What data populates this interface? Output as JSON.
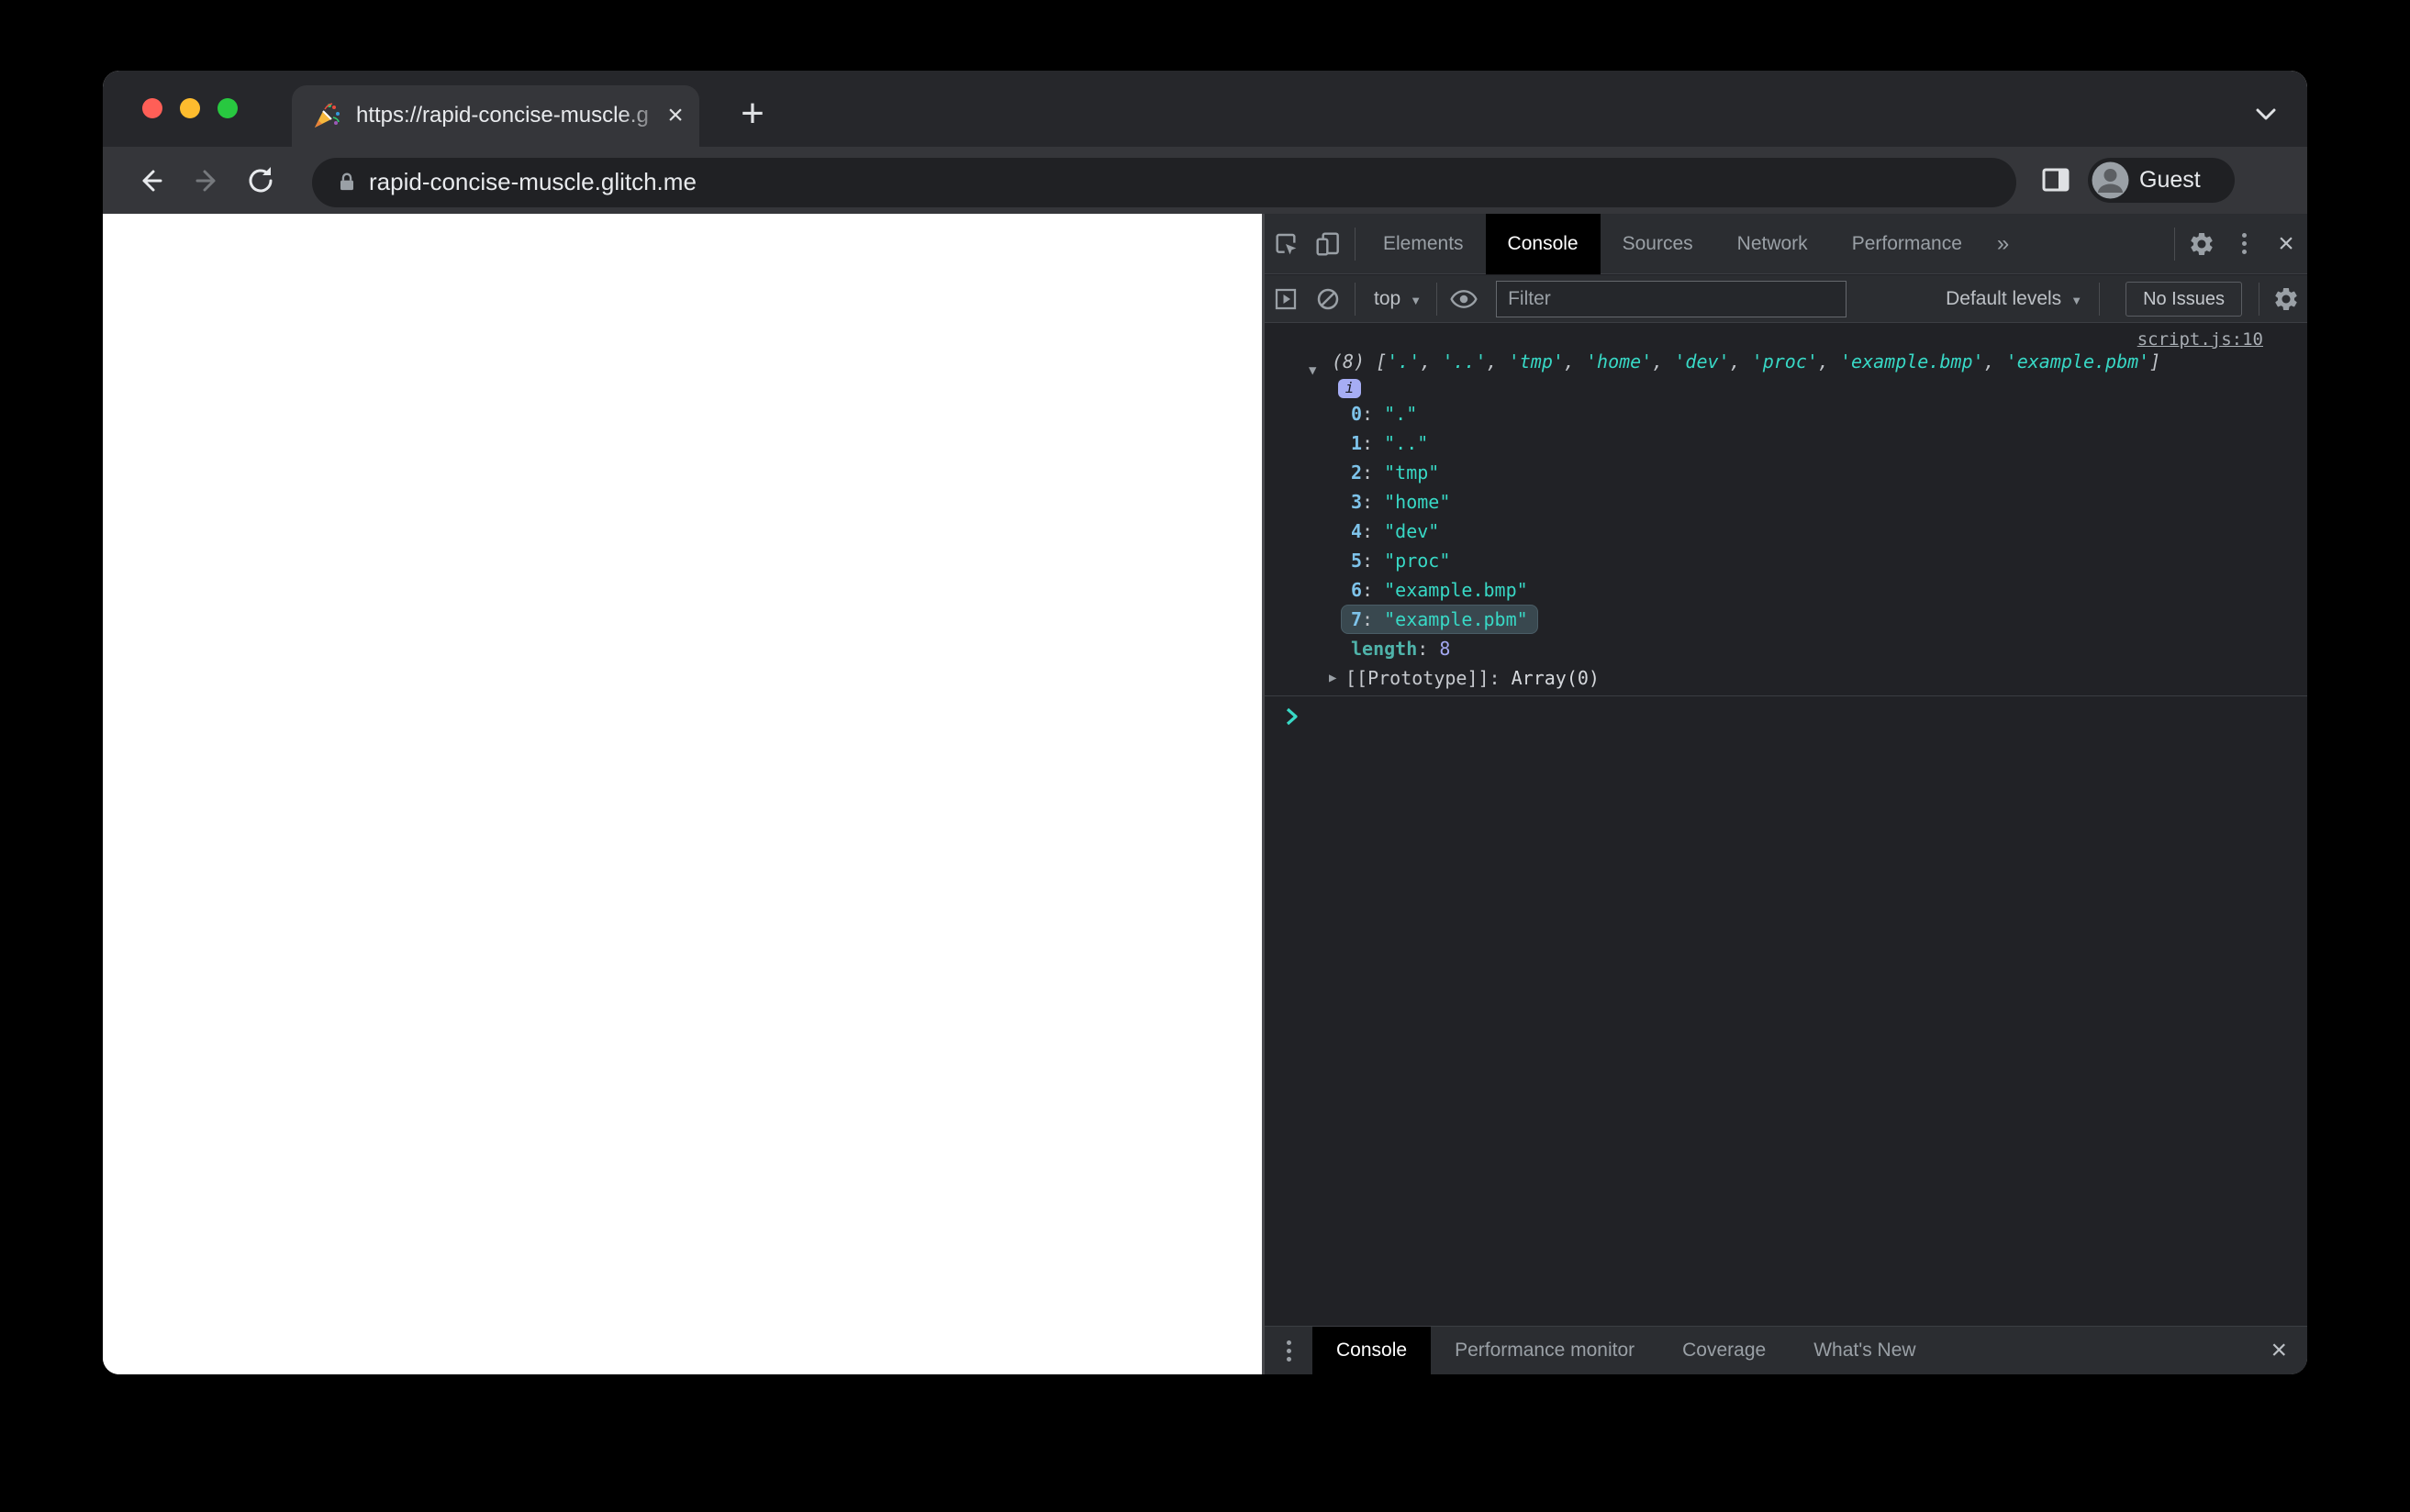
{
  "window": {
    "tab_title": "https://rapid-concise-muscle.g",
    "url": "rapid-concise-muscle.glitch.me",
    "profile": "Guest",
    "new_tab_symbol": "+",
    "tab_close_symbol": "×"
  },
  "devtools": {
    "tabs": [
      {
        "label": "Elements",
        "active": false
      },
      {
        "label": "Console",
        "active": true
      },
      {
        "label": "Sources",
        "active": false
      },
      {
        "label": "Network",
        "active": false
      },
      {
        "label": "Performance",
        "active": false
      }
    ],
    "overflow_symbol": "»",
    "close_symbol": "×",
    "toolbar": {
      "context": "top",
      "filter_placeholder": "Filter",
      "levels": "Default levels",
      "issues": "No Issues"
    },
    "console": {
      "source_link": "script.js:10",
      "count": 8,
      "values": [
        ".",
        "..",
        "tmp",
        "home",
        "dev",
        "proc",
        "example.bmp",
        "example.pbm"
      ],
      "highlighted_index": 7,
      "info_badge": "i",
      "length_label": "length",
      "length_value": "8",
      "prototype_label": "[[Prototype]]",
      "prototype_value": "Array(0)",
      "expand_open_symbol": "▼",
      "expand_closed_symbol": "▶"
    },
    "drawer_tabs": [
      {
        "label": "Console",
        "active": true
      },
      {
        "label": "Performance monitor",
        "active": false
      },
      {
        "label": "Coverage",
        "active": false
      },
      {
        "label": "What's New",
        "active": false
      }
    ]
  },
  "colors": {
    "dt_bg": "#212226",
    "dt_chrome": "#2b2d31",
    "dt_border": "#3c3e43",
    "string_teal": "#38d9c6",
    "index_blue": "#7ec3ea",
    "number_purple": "#a2a7f0",
    "badge_bg": "#a6adf4",
    "length_teal": "#4fb3aa",
    "punct": "#bfc3c8",
    "link_gray": "#a8adb3",
    "proto_gray": "#c6c9ce",
    "highlight_bg": "#39484f",
    "prompt_teal": "#38d9c6",
    "tab_active_bg": "#000000",
    "issues_text": "#c4c8cd"
  }
}
